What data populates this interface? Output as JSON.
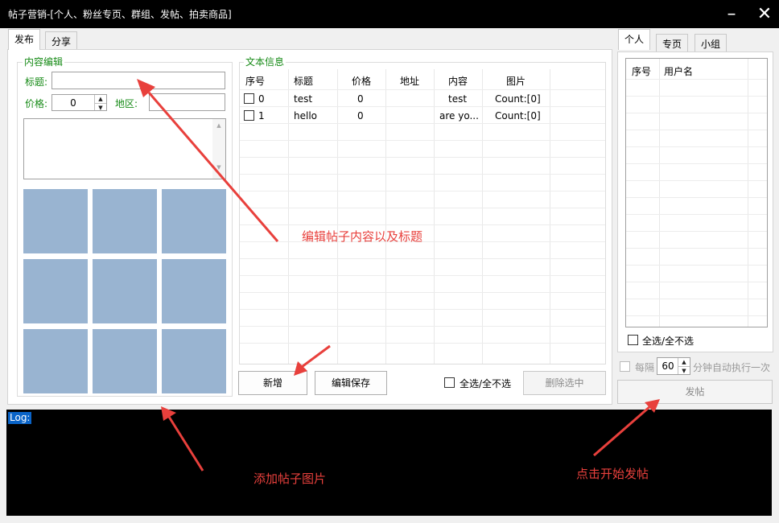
{
  "window": {
    "title": "帖子营销-[个人、粉丝专页、群组、发帖、拍卖商品]",
    "minimize_icon": "minimize-icon",
    "close_icon": "close-icon"
  },
  "main_tabs": [
    "发布",
    "分享"
  ],
  "content_edit": {
    "group_title": "内容编辑",
    "title_label": "标题:",
    "title_value": "",
    "price_label": "价格:",
    "price_value": "0",
    "region_label": "地区:",
    "region_value": "",
    "body_value": ""
  },
  "text_info": {
    "group_title": "文本信息",
    "columns": [
      "序号",
      "标题",
      "价格",
      "地址",
      "内容",
      "图片"
    ],
    "rows": [
      {
        "index": "0",
        "title": "test",
        "price": "0",
        "address": "",
        "content": "test",
        "image": "Count:[0]"
      },
      {
        "index": "1",
        "title": "hello",
        "price": "0",
        "address": "",
        "content": "are yo...",
        "image": "Count:[0]"
      }
    ]
  },
  "buttons": {
    "add": "新增",
    "edit_save": "编辑保存",
    "select_all": "全选/全不选",
    "delete_selected": "删除选中"
  },
  "side_tabs": [
    "个人",
    "专页",
    "小组"
  ],
  "account_list": {
    "columns": [
      "序号",
      "用户名"
    ],
    "select_all": "全选/全不选"
  },
  "auto_run": {
    "prefix": "每隔",
    "interval": "60",
    "suffix": "分钟自动执行一次"
  },
  "post_button": "发帖",
  "log": {
    "label": "Log:"
  },
  "annotations": {
    "edit_content": "编辑帖子内容以及标题",
    "add_images": "添加帖子图片",
    "start_post": "点击开始发帖"
  },
  "colors": {
    "image_cell": "#99b4d1",
    "group_title": "#168a16",
    "annotation": "#e8403c",
    "log_background": "#000000"
  }
}
